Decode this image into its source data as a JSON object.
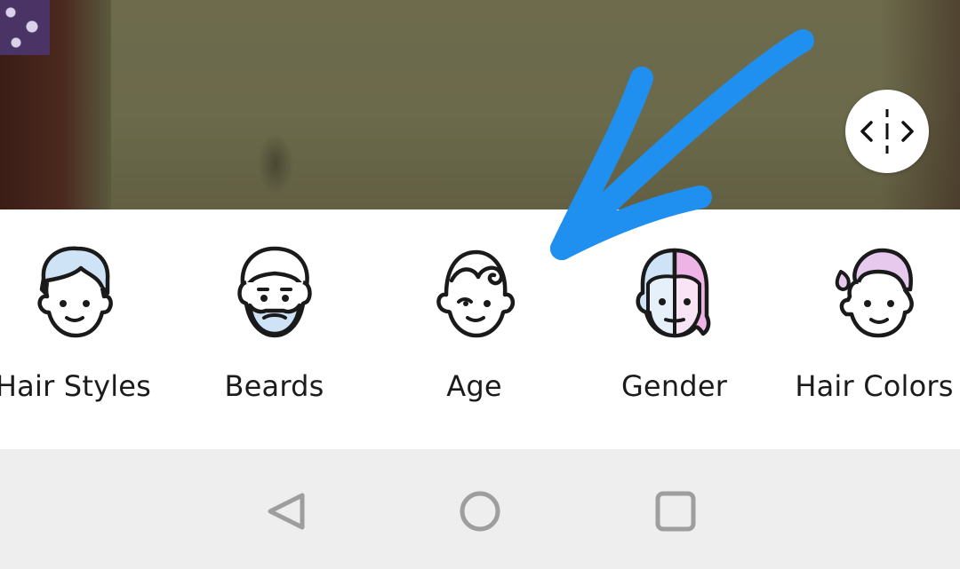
{
  "features": [
    {
      "id": "hair-styles",
      "label": "Hair Styles",
      "icon": "hair-styles-icon"
    },
    {
      "id": "beards",
      "label": "Beards",
      "icon": "beard-icon"
    },
    {
      "id": "age",
      "label": "Age",
      "icon": "age-icon"
    },
    {
      "id": "gender",
      "label": "Gender",
      "icon": "gender-icon"
    },
    {
      "id": "hair-colors",
      "label": "Hair Colors",
      "icon": "hair-colors-icon"
    }
  ],
  "compare": {
    "icon": "compare-split-icon"
  },
  "nav": {
    "back_icon": "back-triangle-icon",
    "home_icon": "home-circle-icon",
    "recents_icon": "recents-square-icon"
  },
  "colors": {
    "arrow": "#1f8ff0",
    "hair_light_blue": "#cfe3f7",
    "hair_pink": "#efb4e6",
    "outline": "#1a1a1a",
    "panel_bg": "#ffffff",
    "nav_bg": "#eeeeee",
    "nav_icon": "#9e9e9e"
  }
}
